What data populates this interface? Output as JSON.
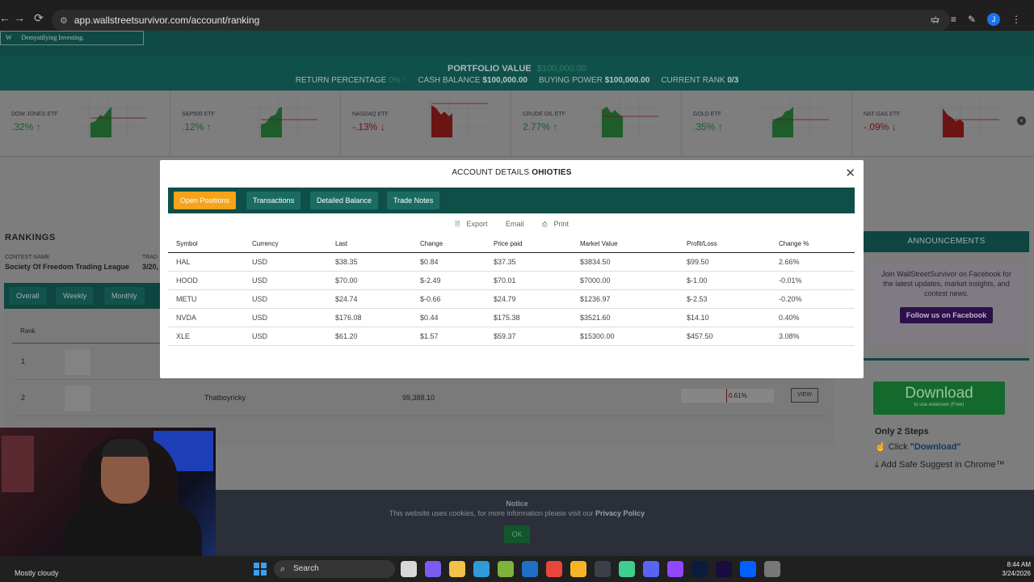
{
  "browser": {
    "url": "app.wallstreetsurvivor.com/account/ranking",
    "profile_initial": "J"
  },
  "site": {
    "tagline": "Demystifying Investing."
  },
  "portfolio": {
    "title": "PORTFOLIO VALUE",
    "value": "$100,000.00",
    "return_label": "RETURN PERCENTAGE",
    "return_value": "0% ↑",
    "cash_label": "CASH BALANCE",
    "cash_value": "$100,000.00",
    "buying_label": "BUYING POWER",
    "buying_value": "$100,000.00",
    "rank_label": "CURRENT RANK",
    "rank_value": "0/3"
  },
  "tickers": [
    {
      "name": "DOW JONES ETF",
      "pct": ".32% ↑",
      "dir": "up"
    },
    {
      "name": "S&P500 ETF",
      "pct": ".12% ↑",
      "dir": "up"
    },
    {
      "name": "NASDAQ ETF",
      "pct": "-.13% ↓",
      "dir": "down"
    },
    {
      "name": "CRUDE OIL ETF",
      "pct": "2.77% ↑",
      "dir": "up"
    },
    {
      "name": "GOLD ETF",
      "pct": ".35% ↑",
      "dir": "up"
    },
    {
      "name": "NAT GAS ETF",
      "pct": "-.09% ↓",
      "dir": "down"
    }
  ],
  "rankings": {
    "title": "RANKINGS",
    "contest_label": "CONTEST NAME",
    "contest_name": "Society Of Freedom Trading League",
    "trade_label": "TRAD",
    "trade_date": "3/20,",
    "tabs": [
      "Overall",
      "Weekly",
      "Monthly"
    ],
    "rank_header": "Rank",
    "rows": [
      {
        "rank": "1",
        "user": "",
        "value": "",
        "pct": ""
      },
      {
        "rank": "2",
        "user": "Thatboyricky",
        "value": "99,388.10",
        "pct": "0.61%"
      }
    ],
    "view_label": "VIEW"
  },
  "announcements": {
    "title": "ANNOUNCEMENTS",
    "text": "Join WallStreetSurvivor on Facebook for the latest updates, market insights, and contest news.",
    "button": "Follow us on Facebook"
  },
  "ad": {
    "download": "Download",
    "sub": "to use extension (Free)",
    "steps_title": "Only 2 Steps",
    "step1_prefix": "Click ",
    "step1_link": "\"Download\"",
    "step2": "Add Safe Suggest in Chrome™"
  },
  "cookie": {
    "title": "Notice",
    "text": "This website uses cookies, for more information please visit our",
    "link": "Privacy Policy",
    "ok": "OK"
  },
  "modal": {
    "title_prefix": "ACCOUNT DETAILS",
    "title_user": "OHIOTIES",
    "tabs": [
      "Open Positions",
      "Transactions",
      "Detailed Balance",
      "Trade Notes"
    ],
    "actions": {
      "export": "Export",
      "email": "Email",
      "print": "Print"
    },
    "columns": [
      "Symbol",
      "Currency",
      "Last",
      "Change",
      "Price paid",
      "Market Value",
      "Profit/Loss",
      "Change %"
    ],
    "rows": [
      [
        "HAL",
        "USD",
        "$38.35",
        "$0.84",
        "$37.35",
        "$3834.50",
        "$99.50",
        "2.66%"
      ],
      [
        "HOOD",
        "USD",
        "$70.00",
        "$-2.49",
        "$70.01",
        "$7000.00",
        "$-1.00",
        "-0.01%"
      ],
      [
        "METU",
        "USD",
        "$24.74",
        "$-0.66",
        "$24.79",
        "$1236.97",
        "$-2.53",
        "-0.20%"
      ],
      [
        "NVDA",
        "USD",
        "$176.08",
        "$0.44",
        "$175.38",
        "$3521.60",
        "$14.10",
        "0.40%"
      ],
      [
        "XLE",
        "USD",
        "$61.20",
        "$1.57",
        "$59.37",
        "$15300.00",
        "$457.50",
        "3.08%"
      ]
    ]
  },
  "taskbar": {
    "weather": "Mostly cloudy",
    "search": "Search",
    "time": "8:44 AM",
    "date": "3/24/2026"
  }
}
